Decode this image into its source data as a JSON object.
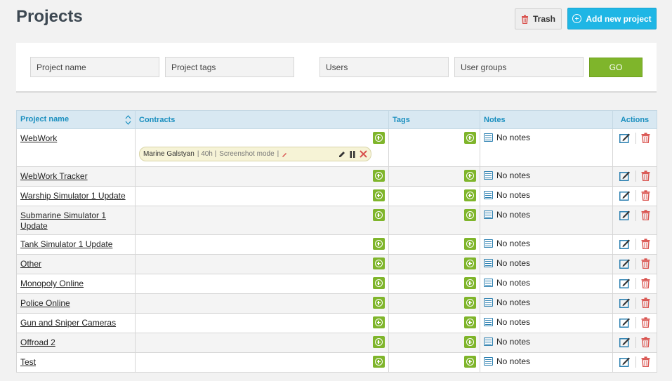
{
  "header": {
    "title": "Projects",
    "trash_label": "Trash",
    "add_label": "Add new project"
  },
  "filters": {
    "project_name_placeholder": "Project name",
    "project_tags_placeholder": "Project tags",
    "users_placeholder": "Users",
    "user_groups_placeholder": "User groups",
    "go_label": "GO"
  },
  "table": {
    "columns": [
      "Project name",
      "Contracts",
      "Tags",
      "Notes",
      "Actions"
    ],
    "contract": {
      "user": "Marine  Galstyan",
      "hours": "| 40h |",
      "mode": "Screenshot mode",
      "tail": "|"
    },
    "rows": [
      {
        "name": "WebWork",
        "notes": "No  notes"
      },
      {
        "name": "WebWork  Tracker",
        "notes": "No  notes"
      },
      {
        "name": "Warship  Simulator  1  Update",
        "notes": "No  notes"
      },
      {
        "name": "Submarine  Simulator  1  Update",
        "notes": "No  notes"
      },
      {
        "name": "Tank  Simulator  1  Update",
        "notes": "No  notes"
      },
      {
        "name": "Other",
        "notes": "No  notes"
      },
      {
        "name": "Monopoly  Online",
        "notes": "No  notes"
      },
      {
        "name": "Police  Online",
        "notes": "No  notes"
      },
      {
        "name": "Gun  and  Sniper  Cameras",
        "notes": "No  notes"
      },
      {
        "name": "Offroad  2",
        "notes": "No  notes"
      },
      {
        "name": "Test",
        "notes": "No  notes"
      }
    ]
  },
  "colors": {
    "accent_blue": "#1fb6e5",
    "go_green": "#7fb52b",
    "header_blue": "#1a8fbf",
    "delete_red": "#d9534f"
  }
}
